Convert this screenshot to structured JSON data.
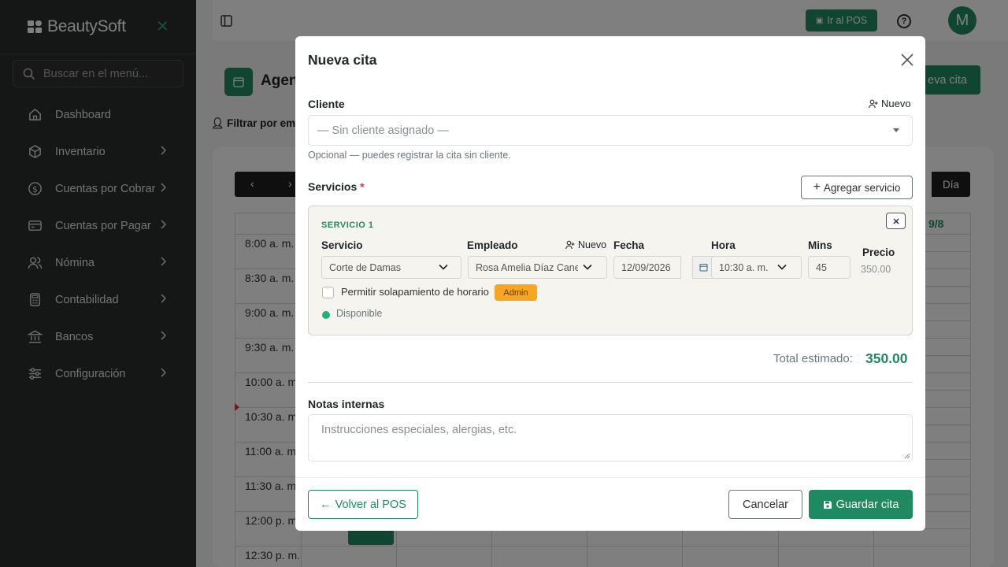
{
  "sidebar": {
    "brand": "BeautySoft",
    "search_placeholder": "Buscar en el menú...",
    "items": [
      {
        "label": "Dashboard",
        "icon": "home-icon"
      },
      {
        "label": "Inventario",
        "icon": "box-icon"
      },
      {
        "label": "Cuentas por Cobrar",
        "icon": "dollar-icon"
      },
      {
        "label": "Cuentas por Pagar",
        "icon": "card-icon"
      },
      {
        "label": "Nómina",
        "icon": "users-icon"
      },
      {
        "label": "Contabilidad",
        "icon": "calculator-icon"
      },
      {
        "label": "Bancos",
        "icon": "bank-icon"
      },
      {
        "label": "Configuración",
        "icon": "sliders-icon"
      }
    ]
  },
  "header": {
    "pos_button": "Ir al POS",
    "help": "?",
    "avatar": "M"
  },
  "background": {
    "page_title": "Agen",
    "new_button": "eva cita",
    "filter_label": "Filtrar por emp",
    "view_day": "Día",
    "date_partial": "9/8",
    "times": [
      "8:00 a. m.",
      "8:30 a. m.",
      "9:00 a. m.",
      "9:30 a. m.",
      "10:00 a. m.",
      "10:30 a. m.",
      "11:00 a. m.",
      "11:30 a. m.",
      "12:00 p. m.",
      "12:30 p. m."
    ]
  },
  "modal": {
    "title": "Nueva cita",
    "client_label": "Cliente",
    "client_new": "Nuevo",
    "client_select": "— Sin cliente asignado —",
    "client_hint": "Opcional — puedes registrar la cita sin cliente.",
    "services_label": "Servicios",
    "required_mark": "*",
    "add_service": "Agregar servicio",
    "service": {
      "title": "SERVICIO 1",
      "service_label": "Servicio",
      "service_value": "Corte de Damas",
      "employee_label": "Empleado",
      "employee_new": "Nuevo",
      "employee_value": "Rosa Amelia Díaz Cane",
      "date_label": "Fecha",
      "date_value": "12/09/2026",
      "time_label": "Hora",
      "time_value": "10:30 a. m.",
      "mins_label": "Mins",
      "mins_value": "45",
      "price_label": "Precio",
      "price_value": "350.00",
      "overlap_label": "Permitir solapamiento de horario",
      "admin_badge": "Admin",
      "status": "Disponible",
      "status_color": "#22b07d"
    },
    "total_label": "Total estimado:",
    "total_value": "350.00",
    "notes_label": "Notas internas",
    "notes_placeholder": "Instrucciones especiales, alergias, etc.",
    "back_button": "Volver al POS",
    "cancel_button": "Cancelar",
    "save_button": "Guardar cita"
  },
  "colors": {
    "accent": "#1f8a62",
    "sidebar": "#2b2d2c",
    "badge": "#f5a623"
  }
}
